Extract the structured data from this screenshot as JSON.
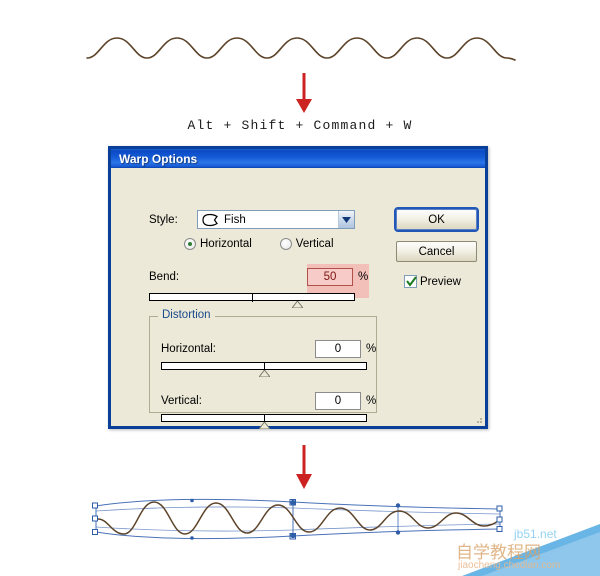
{
  "figure": {
    "shortcut_text": "Alt + Shift + Command + W",
    "wave_stroke_color": "#5c4329",
    "arrow_color": "#cc2222",
    "selection_color": "#4a72b8",
    "top_wave_label": "original-wave-artwork",
    "bottom_wave_label": "warped-wave-artwork",
    "arrow_1_label": "down-arrow-step-1",
    "arrow_2_label": "down-arrow-step-2"
  },
  "watermark": {
    "site": "jb51.net",
    "url": "jiaocheng.chedian.com",
    "cn": "自学教程网"
  },
  "dialog": {
    "title": "Warp Options",
    "titlebar_color": "#1358d4",
    "body_color": "#ece9d8",
    "style": {
      "label": "Style:",
      "value": "Fish",
      "icon": "warp-fish-icon"
    },
    "orientation": {
      "horizontal_label": "Horizontal",
      "vertical_label": "Vertical",
      "selected": "Horizontal"
    },
    "bend": {
      "label": "Bend:",
      "value": "50",
      "unit": "%",
      "slider_percent": 72,
      "highlighted": true,
      "highlight_color": "#f4b9b4"
    },
    "distortion": {
      "title": "Distortion",
      "horizontal": {
        "label": "Horizontal:",
        "value": "0",
        "unit": "%",
        "slider_percent": 50
      },
      "vertical": {
        "label": "Vertical:",
        "value": "0",
        "unit": "%",
        "slider_percent": 50
      }
    },
    "buttons": {
      "ok": "OK",
      "cancel": "Cancel"
    },
    "preview": {
      "label": "Preview",
      "checked": true
    }
  }
}
